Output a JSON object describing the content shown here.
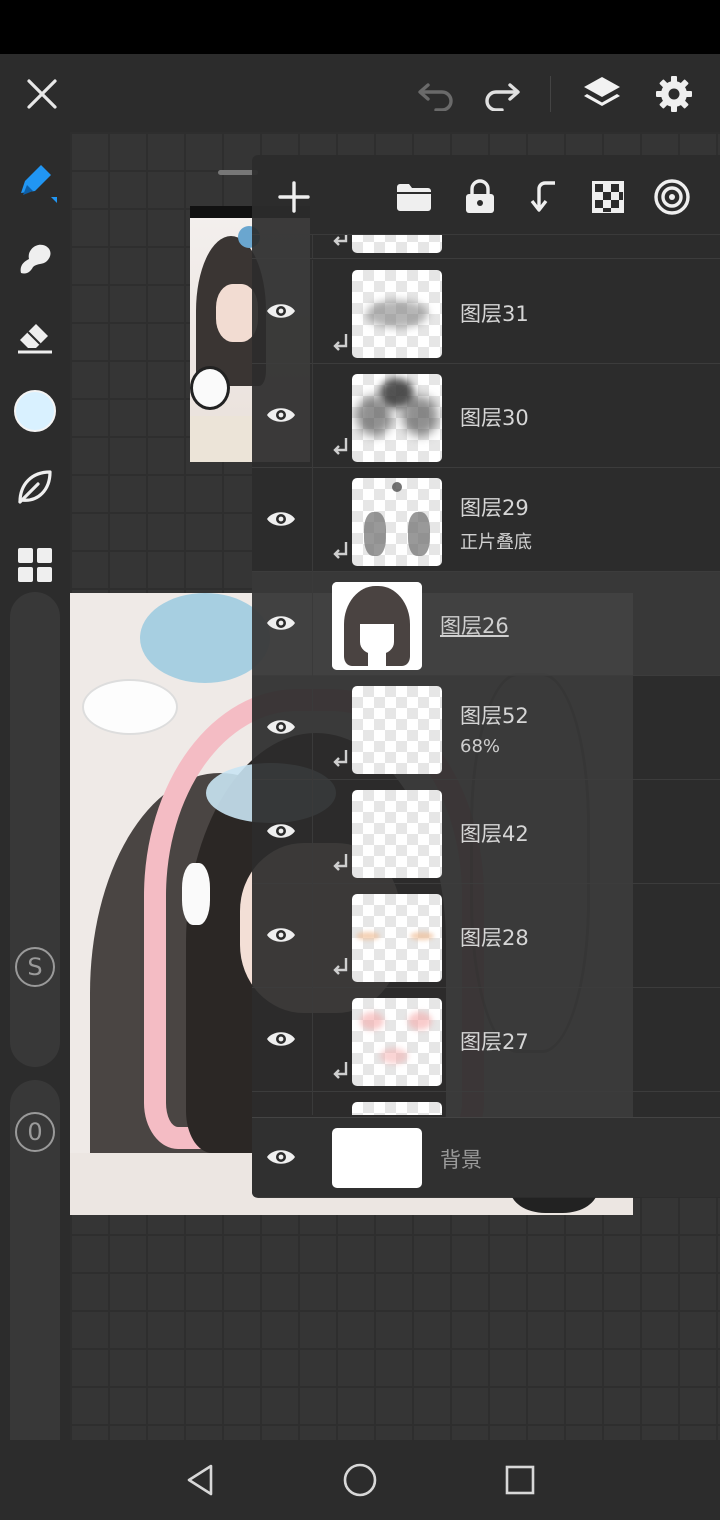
{
  "top_bar": {
    "icons": [
      "close-icon",
      "undo-icon",
      "redo-icon",
      "layers-icon",
      "settings-icon"
    ],
    "accent_color": "#2196f3"
  },
  "left_toolbar": {
    "tools": [
      "brush-icon",
      "smudge-icon",
      "eraser-icon",
      "color-swatch",
      "leaf-icon",
      "gallery-icon"
    ],
    "current_color": "#d9f1ff",
    "size_label": "S",
    "opacity_label": "0"
  },
  "layers_panel": {
    "toolbar_icons": [
      "add-icon",
      "folder-icon",
      "lock-icon",
      "clip-icon",
      "checker-icon",
      "target-icon"
    ],
    "layers": [
      {
        "name": "图层31",
        "sub": ""
      },
      {
        "name": "图层30",
        "sub": ""
      },
      {
        "name": "图层29",
        "sub": "正片叠底"
      },
      {
        "name": "图层26",
        "sub": ""
      },
      {
        "name": "图层52",
        "sub": "68%"
      },
      {
        "name": "图层42",
        "sub": ""
      },
      {
        "name": "图层28",
        "sub": ""
      },
      {
        "name": "图层27",
        "sub": ""
      }
    ],
    "background_label": "背景"
  },
  "nav_bar": {
    "icons": [
      "back-icon",
      "home-icon",
      "recents-icon"
    ]
  }
}
